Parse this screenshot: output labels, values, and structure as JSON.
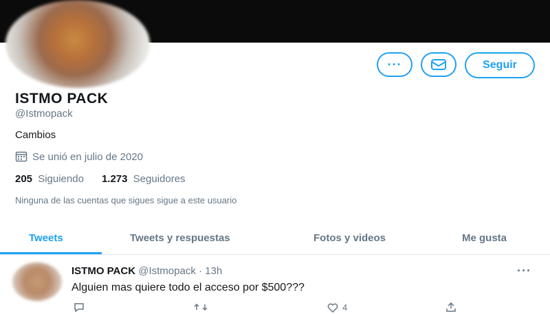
{
  "profile": {
    "name": "ISTMO PACK",
    "handle": "@Istmopack",
    "bio": "Cambios",
    "joined": "Se unió en julio de 2020",
    "following_count": "205",
    "following_label": "Siguiendo",
    "followers_count": "1.273",
    "followers_label": "Seguidores",
    "notice": "Ninguna de las cuentas que sigues sigue a este usuario"
  },
  "actions": {
    "more_label": "···",
    "follow_label": "Seguir"
  },
  "tabs": [
    {
      "label": "Tweets",
      "active": true
    },
    {
      "label": "Tweets y respuestas",
      "active": false
    },
    {
      "label": "Fotos y videos",
      "active": false
    },
    {
      "label": "Me gusta",
      "active": false
    }
  ],
  "tweet": {
    "name": "ISTMO PACK",
    "meta": "@Istmopack · 13h",
    "text": "Alguien mas quiere todo el acceso por $500???",
    "more_label": "···",
    "reply_count": "",
    "retweet_count": "",
    "like_count": "4"
  },
  "colors": {
    "accent": "#1da1f2",
    "text": "#14171a",
    "secondary": "#657786",
    "banner": "#0b0b0b"
  },
  "icons": {
    "more": "more-dots-icon",
    "mail": "mail-icon",
    "calendar": "calendar-icon"
  }
}
